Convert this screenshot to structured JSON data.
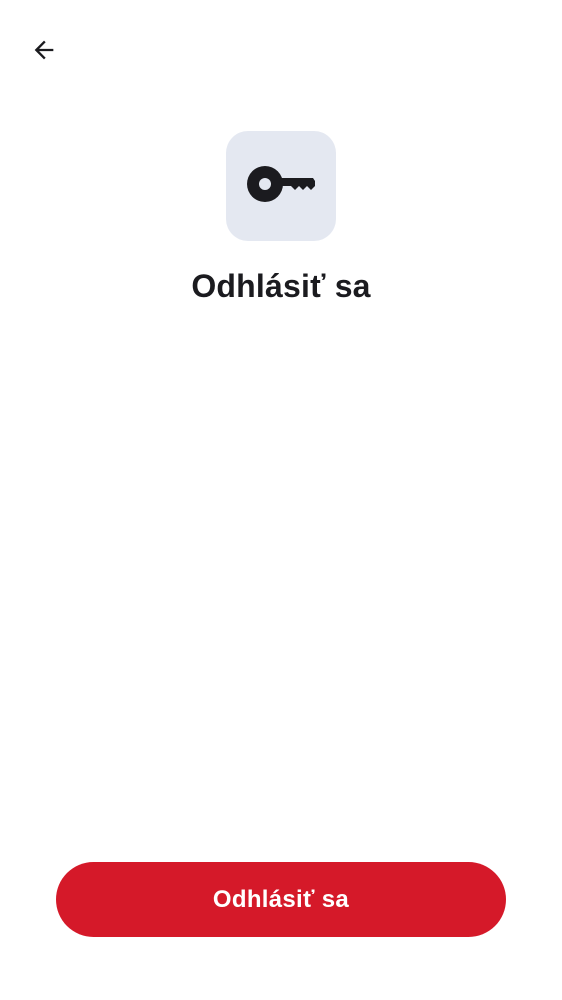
{
  "header": {
    "back_icon": "arrow-back-icon"
  },
  "hero": {
    "icon": "key-icon",
    "tile_color": "#e4e8f1",
    "title": "Odhlásiť sa"
  },
  "actions": {
    "logout_label": "Odhlásiť sa",
    "logout_color": "#d51929"
  }
}
